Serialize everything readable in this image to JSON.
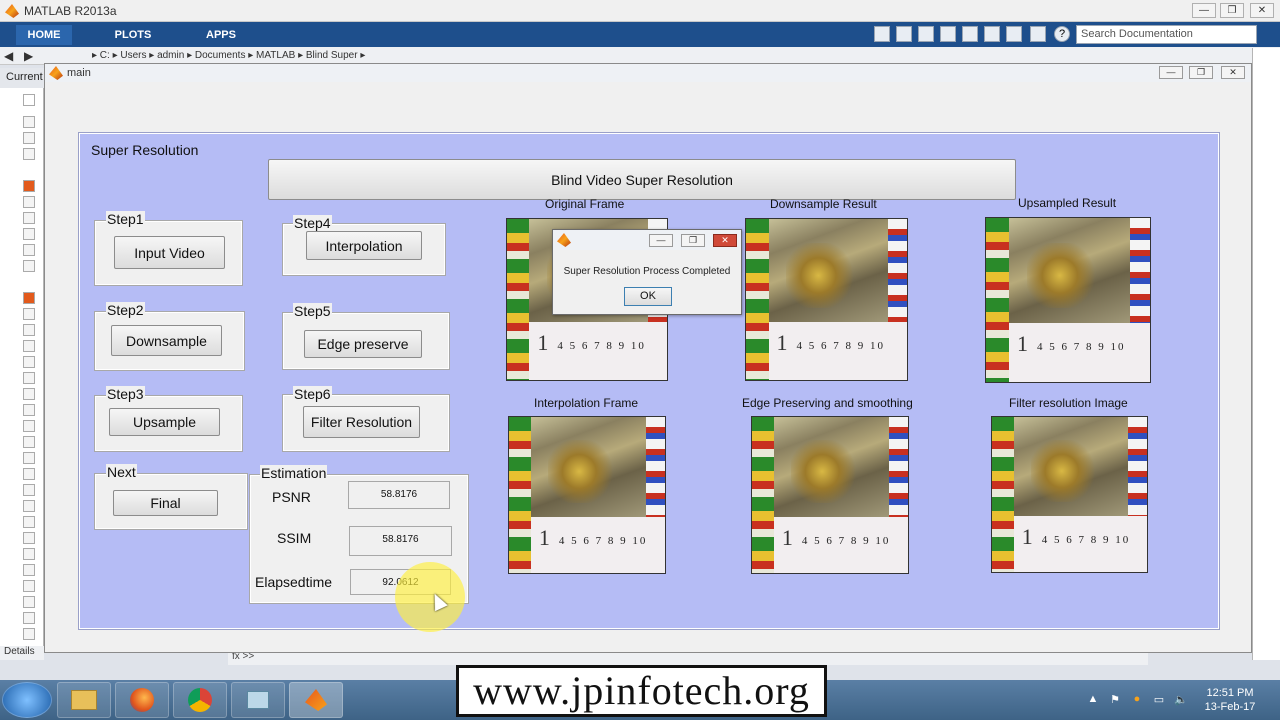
{
  "matlab": {
    "title": "MATLAB R2013a",
    "tabs": [
      "HOME",
      "PLOTS",
      "APPS"
    ],
    "search_placeholder": "Search Documentation",
    "address": "▸ C: ▸ Users ▸ admin ▸ Documents ▸ MATLAB ▸ Blind Super ▸",
    "current_folder_label": "Current",
    "details_label": "Details",
    "command_prompt": "fx >>",
    "winbtns": [
      "—",
      "❐",
      "✕"
    ]
  },
  "figure": {
    "title": "main",
    "panel_title": "Super Resolution",
    "header_button": "Blind Video Super Resolution",
    "steps": [
      {
        "label": "Step1",
        "button": "Input Video"
      },
      {
        "label": "Step2",
        "button": "Downsample"
      },
      {
        "label": "Step3",
        "button": "Upsample"
      },
      {
        "label": "Next",
        "button": "Final"
      },
      {
        "label": "Step4",
        "button": "Interpolation"
      },
      {
        "label": "Step5",
        "button": "Edge preserve"
      },
      {
        "label": "Step6",
        "button": "Filter  Resolution"
      }
    ],
    "estimation": {
      "title": "Estimation",
      "psnr_label": "PSNR",
      "psnr_value": "58.8176",
      "ssim_label": "SSIM",
      "ssim_value": "58.8176",
      "elapsed_label": "Elapsedtime",
      "elapsed_value": "92.0612"
    },
    "images": [
      {
        "caption": "Original Frame"
      },
      {
        "caption": "Downsample Result"
      },
      {
        "caption": "Upsampled Result"
      },
      {
        "caption": "Interpolation Frame"
      },
      {
        "caption": "Edge Preserving and smoothing"
      },
      {
        "caption": "Filter resolution Image"
      }
    ],
    "calendar_text": "4 5 6 7 8 9 10",
    "calendar_big": "1"
  },
  "dialog": {
    "message": "Super Resolution Process Completed",
    "ok": "OK"
  },
  "taskbar": {
    "time": "12:51 PM",
    "date": "13-Feb-17"
  },
  "watermark": "www.jpinfotech.org",
  "colors": {
    "panel_bg": "#b5bcf5",
    "toolstrip": "#1e4f8c",
    "highlight": "#fff03c"
  },
  "icons": [
    "matlab-logo-icon",
    "folder-icon",
    "firefox-icon",
    "chrome-icon",
    "start-icon",
    "help-icon",
    "search-icon"
  ]
}
